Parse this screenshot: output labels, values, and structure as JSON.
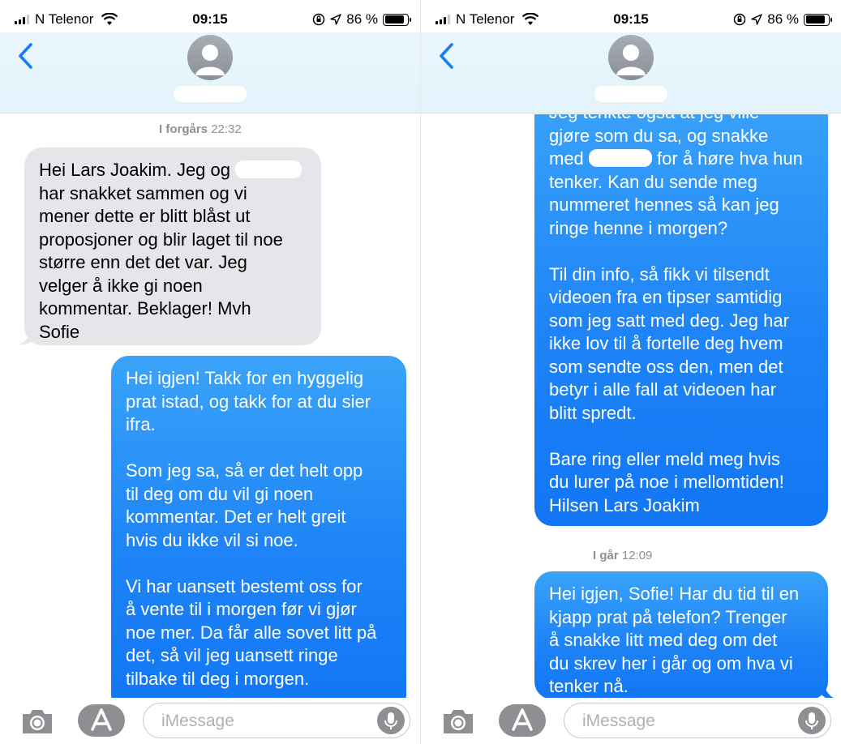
{
  "status_bar": {
    "carrier": "N Telenor",
    "time": "09:15",
    "battery": "86 %",
    "battery_level": 0.86
  },
  "left": {
    "timestamp_day": "I forgårs",
    "timestamp_time": "22:32",
    "incoming": {
      "line1_a": "Hei Lars Joakim. Jeg og",
      "rest": "har snakket sammen og vi\nmener dette er blitt blåst ut\nproposjoner og blir laget til noe\nstørre enn det det var. Jeg\nvelger å ikke gi noen\nkommentar. Beklager! Mvh\nSofie"
    },
    "outgoing": "Hei igjen! Takk for en hyggelig\nprat istad, og takk for at du sier\nifra.\n\nSom jeg sa, så er det helt opp\ntil deg om du vil gi noen\nkommentar. Det er helt greit\nhvis du ikke vil si noe.\n\nVi har uansett bestemt oss for\nå vente til i morgen før vi gjør\nnoe mer. Da får alle sovet litt på\ndet, så vil jeg uansett ringe\ntilbake til deg i morgen."
  },
  "right": {
    "outgoing_top": {
      "line1": "Jeg tenkte også at jeg ville",
      "line2": "gjøre som du sa, og snakke",
      "line3_a": "med",
      "line3_b": "for å høre hva hun",
      "rest": "tenker. Kan du sende meg\nnummeret hennes så kan jeg\nringe henne i morgen?\n\nTil din info, så fikk vi tilsendt\nvideoen fra en tipser samtidig\nsom jeg satt med deg. Jeg har\nikke lov til å fortelle deg hvem\nsom sendte oss den, men det\nbetyr i alle fall at videoen har\nblitt spredt.\n\nBare ring eller meld meg hvis\ndu lurer på noe i mellomtiden!\nHilsen Lars Joakim"
    },
    "timestamp_day": "I går",
    "timestamp_time": "12:09",
    "outgoing_bottom": "Hei igjen, Sofie! Har du tid til en\nkjapp prat på telefon? Trenger\nå snakke litt med deg om det\ndu skrev her i går og om hva vi\ntenker nå."
  },
  "input": {
    "placeholder": "iMessage"
  },
  "icons": {
    "back": "chevron-left-icon",
    "avatar": "person-icon",
    "camera": "camera-icon",
    "apps": "app-store-icon",
    "mic": "microphone-icon",
    "wifi": "wifi-icon",
    "lock_rotation": "orientation-lock-icon",
    "location": "location-arrow-icon"
  },
  "colors": {
    "accent": "#1a7cf5",
    "incoming_bubble": "#e5e5ea",
    "header_bg": "#e6f4fc"
  }
}
